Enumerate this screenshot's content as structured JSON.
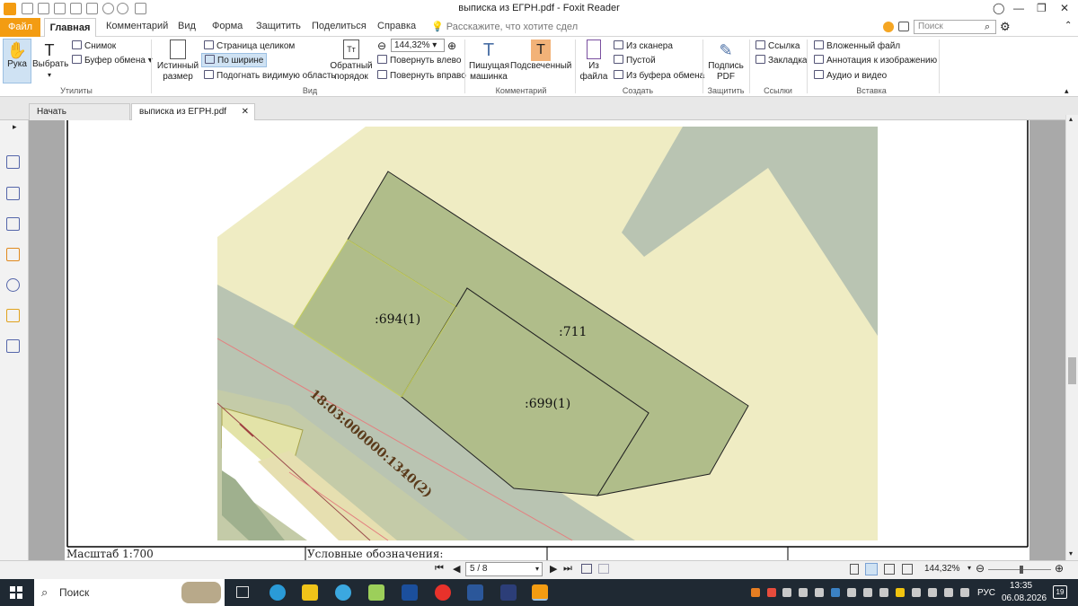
{
  "window": {
    "title": "выписка из ЕГРН.pdf - Foxit Reader"
  },
  "menu": {
    "file": "Файл",
    "home": "Главная",
    "items": [
      "Комментарий",
      "Вид",
      "Форма",
      "Защитить",
      "Поделиться",
      "Справка"
    ],
    "tellme": "Расскажите, что хотите сдел",
    "search_placeholder": "Поиск"
  },
  "ribbon": {
    "hand": "Рука",
    "select": "Выбрать",
    "snapshot": "Снимок",
    "clipboard": "Буфер обмена",
    "group_utils": "Утилиты",
    "actual_size_1": "Истинный",
    "actual_size_2": "размер",
    "fit_page": "Страница целиком",
    "fit_width": "По ширине",
    "fit_visible": "Подогнать видимую область",
    "zoom": "144,32%",
    "rotate_left": "Повернуть влево",
    "rotate_right": "Повернуть вправо",
    "reverse_1": "Обратный",
    "reverse_2": "порядок",
    "group_view": "Вид",
    "typewriter_1": "Пишущая",
    "typewriter_2": "машинка",
    "highlight": "Подсвеченный",
    "group_comments": "Комментарий",
    "from_file_1": "Из",
    "from_file_2": "файла",
    "from_scanner": "Из сканера",
    "blank": "Пустой",
    "from_clipboard": "Из буфера обмена",
    "group_create": "Создать",
    "sign_1": "Подпись",
    "sign_2": "PDF",
    "group_protect": "Защитить",
    "link": "Ссылка",
    "bookmark": "Закладка",
    "group_links": "Ссылки",
    "attachment": "Вложенный файл",
    "image_annotation": "Аннотация к изображению",
    "audio_video": "Аудио и видео",
    "group_insert": "Вставка"
  },
  "tabs": [
    "Начать",
    "выписка из ЕГРН.pdf"
  ],
  "map": {
    "labels": [
      ":694(1)",
      ":711",
      ":699(1)",
      "18:03:000000:1340(2)"
    ]
  },
  "legend": {
    "scale": "Масштаб 1:700",
    "conventions": "Условные обозначения:"
  },
  "status": {
    "page": "5 / 8",
    "zoom": "144,32%"
  },
  "taskbar": {
    "search": "Поиск",
    "lang": "РУС",
    "time": "13:35",
    "date": "06.08.2026",
    "notif": "19"
  },
  "colors": {
    "accent": "#f39c12",
    "parcel": "#b0bd8a",
    "road": "#b9c4b2",
    "background_land": "#efecc3"
  }
}
